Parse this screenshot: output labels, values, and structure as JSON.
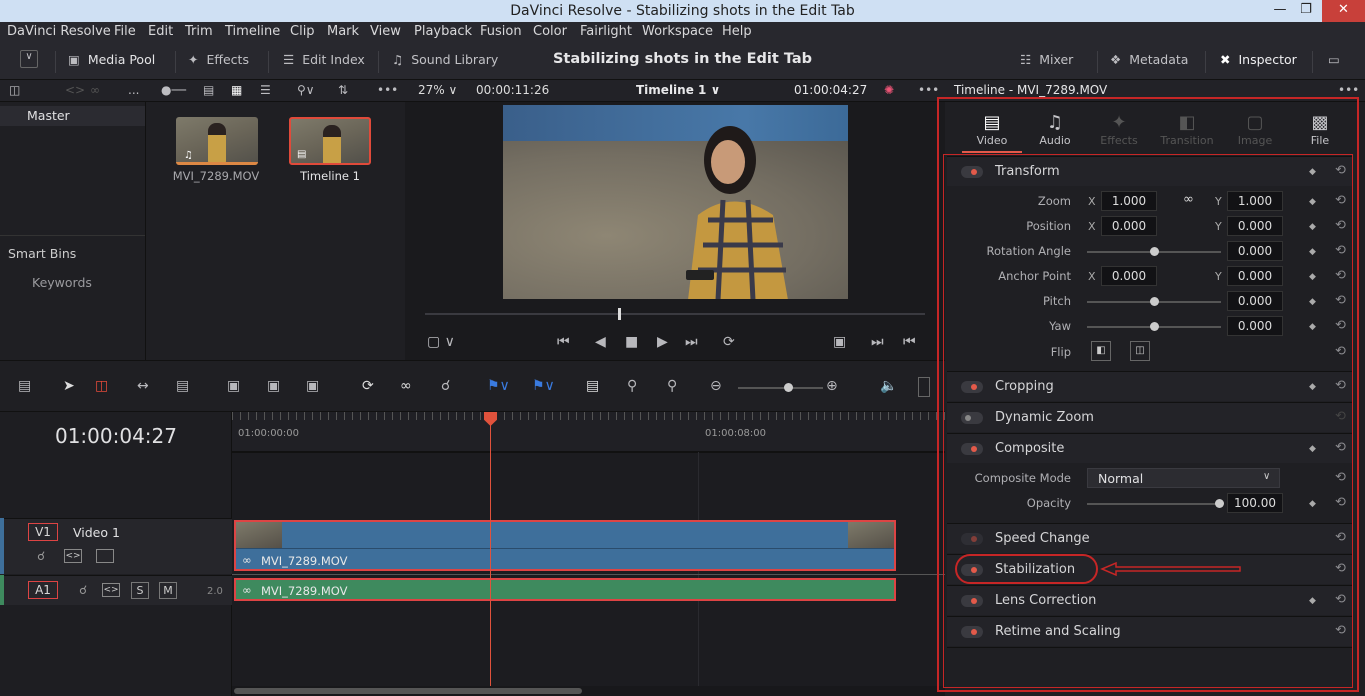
{
  "window": {
    "title": "DaVinci Resolve - Stabilizing shots in the Edit Tab"
  },
  "menu": [
    "DaVinci Resolve",
    "File",
    "Edit",
    "Trim",
    "Timeline",
    "Clip",
    "Mark",
    "View",
    "Playback",
    "Fusion",
    "Color",
    "Fairlight",
    "Workspace",
    "Help"
  ],
  "toolbar": {
    "media_pool": "Media Pool",
    "effects": "Effects",
    "edit_index": "Edit Index",
    "sound_library": "Sound Library",
    "page_title": "Stabilizing shots in the Edit Tab",
    "mixer": "Mixer",
    "metadata": "Metadata",
    "inspector": "Inspector"
  },
  "subbar": {
    "dots": "...",
    "zoom": "27%",
    "duration": "00:00:11:26",
    "timeline_name": "Timeline 1",
    "timecode": "01:00:04:27",
    "inspector_title": "Timeline - MVI_7289.MOV"
  },
  "bins": {
    "master": "Master",
    "smart_bins": "Smart Bins",
    "keywords": "Keywords"
  },
  "media": [
    {
      "name": "MVI_7289.MOV"
    },
    {
      "name": "Timeline 1"
    }
  ],
  "timeline": {
    "timecode": "01:00:04:27",
    "ruler_labels": [
      "01:00:00:00",
      "01:00:08:00"
    ],
    "video_track": {
      "id": "V1",
      "name": "Video 1",
      "clip": "MVI_7289.MOV"
    },
    "audio_track": {
      "id": "A1",
      "solo": "S",
      "mute": "M",
      "level": "2.0",
      "clip": "MVI_7289.MOV"
    }
  },
  "inspector": {
    "tabs": [
      {
        "label": "Video",
        "icon": "film-icon"
      },
      {
        "label": "Audio",
        "icon": "note-icon"
      },
      {
        "label": "Effects",
        "icon": "wand-icon"
      },
      {
        "label": "Transition",
        "icon": "transition-icon"
      },
      {
        "label": "Image",
        "icon": "image-icon"
      },
      {
        "label": "File",
        "icon": "file-icon"
      }
    ],
    "transform": {
      "title": "Transform",
      "zoom_label": "Zoom",
      "zoom_x": "1.000",
      "zoom_y": "1.000",
      "position_label": "Position",
      "pos_x": "0.000",
      "pos_y": "0.000",
      "rotation_label": "Rotation Angle",
      "rotation": "0.000",
      "anchor_label": "Anchor Point",
      "anchor_x": "0.000",
      "anchor_y": "0.000",
      "pitch_label": "Pitch",
      "pitch": "0.000",
      "yaw_label": "Yaw",
      "yaw": "0.000",
      "flip_label": "Flip",
      "x": "X",
      "y": "Y"
    },
    "cropping": "Cropping",
    "dynamic_zoom": "Dynamic Zoom",
    "composite": {
      "title": "Composite",
      "mode_label": "Composite Mode",
      "mode": "Normal",
      "opacity_label": "Opacity",
      "opacity": "100.00"
    },
    "speed_change": "Speed Change",
    "stabilization": "Stabilization",
    "lens_correction": "Lens Correction",
    "retime": "Retime and Scaling"
  },
  "colors": {
    "accent": "#e35a4a",
    "highlight": "#c62626"
  }
}
